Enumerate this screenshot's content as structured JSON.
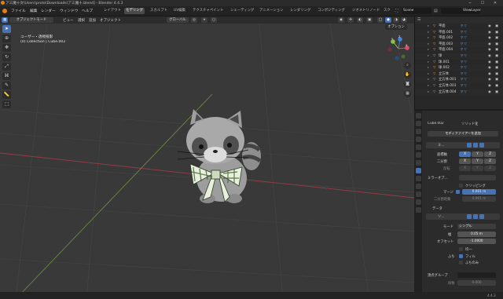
{
  "window": {
    "title": "ア三魔十文\\Users\\proto\\Downloads\\ア三魔十.blend] - Blender 4.4.3",
    "minimize_glyph": "─",
    "maximize_glyph": "☐",
    "close_glyph": "✕"
  },
  "menu": [
    "ファイル",
    "編集",
    "レンダー",
    "ウィンドウ",
    "ヘルプ"
  ],
  "workspaces": [
    "レイアウト",
    "モデリング",
    "スカルプト",
    "UV編集",
    "テクスチャペイント",
    "シェーディング",
    "アニメーション",
    "レンダリング",
    "コンポジティング",
    "ジオメトリノード",
    "スク"
  ],
  "active_workspace": "モデリング",
  "scene_label": "Scene",
  "view_layer_label": "ViewLayer",
  "viewport_header": {
    "mode": "オブジェクトモード",
    "menus": [
      "ビュー",
      "選択",
      "追加",
      "オブジェクト"
    ],
    "transform_orientation": "グローバル",
    "options": "オプション"
  },
  "viewport_info": {
    "view_name": "ユーザー・透視投影",
    "collection_path": "(0) Collection | Cube.002"
  },
  "nav_gizmo": {
    "x_label": "X",
    "y_label": "Y",
    "z_label": "Z"
  },
  "tools": [
    "select",
    "cursor",
    "move",
    "rotate",
    "scale",
    "transform",
    "annotate",
    "measure",
    "add-cube"
  ],
  "outliner": {
    "items": [
      "平面",
      "平面.001",
      "平面.002",
      "平面.003",
      "平面.004",
      "球",
      "球.001",
      "球.002",
      "立方体",
      "立方体.001",
      "立方体.003",
      "立方体.004"
    ]
  },
  "properties": {
    "object_name": "Cube.002",
    "mesh_name": "ソリッド化",
    "add_modifier": "モディファイアーを追加",
    "mirror_header": "ミ...",
    "axis_label": "座標軸",
    "bisect_label": "二分割",
    "flip_label": "反転",
    "axes": [
      "X",
      "Y",
      "Z"
    ],
    "mirror_object_label": "ミラーオブ...",
    "clipping_label": "クリッピング",
    "merge_label": "マージ",
    "merge_value": "0.001 m",
    "bisect_dist_label": "二分割距離",
    "bisect_dist_value": "0.001 m",
    "data_label": "データ",
    "solidify_header": "ソ...",
    "mode_label": "モード",
    "mode_value": "シンプル",
    "thickness_label": "幅",
    "thickness_value": "0.05 m",
    "offset_label": "オフセット",
    "offset_value": "-1.0000",
    "even_label": "均一",
    "rim_label": "ふち",
    "fill_label": "フィル",
    "rim_only_label": "ふちのみ",
    "vgroup_label": "頂点グループ",
    "factor_label": "係数",
    "factor_value": "0.000"
  },
  "status_version": "4.4.3",
  "colors": {
    "accent": "#4772b3",
    "x_axis": "#e44c63",
    "y_axis": "#8bc34a",
    "z_axis": "#3f86d6"
  }
}
